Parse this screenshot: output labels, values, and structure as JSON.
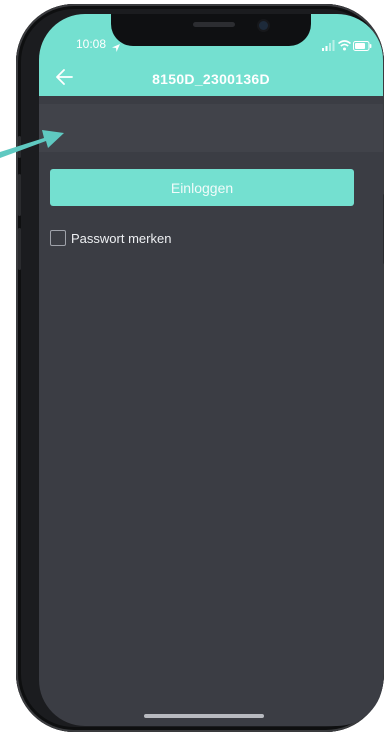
{
  "status_bar": {
    "time": "10:08",
    "icons": [
      "location-arrow-icon",
      "signal-icon",
      "wifi-icon",
      "battery-icon"
    ]
  },
  "app_bar": {
    "title": "8150D_2300136D",
    "back_icon": "back-arrow-icon"
  },
  "login": {
    "password_field_value": "",
    "button_label": "Einloggen",
    "remember_label": "Passwort merken",
    "remember_checked": false
  },
  "colors": {
    "accent": "#74e0d0",
    "background": "#3b3d44",
    "field_band": "#41434a",
    "frame": "#1b1c1f"
  }
}
